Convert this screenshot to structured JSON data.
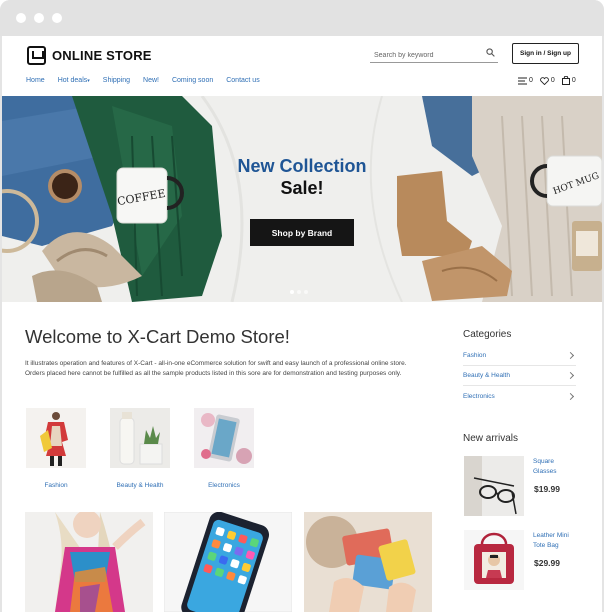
{
  "header": {
    "logo_text": "ONLINE STORE",
    "search_placeholder": "Search by keyword",
    "signin_label": "Sign in / Sign up",
    "nav": [
      "Home",
      "Hot deals",
      "Shipping",
      "New!",
      "Coming soon",
      "Contact us"
    ],
    "icons": [
      {
        "name": "compare-icon",
        "count": "0"
      },
      {
        "name": "wishlist-icon",
        "count": "0"
      },
      {
        "name": "cart-icon",
        "count": "0"
      }
    ]
  },
  "hero": {
    "title": "New Collection",
    "subtitle": "Sale!",
    "button_label": "Shop by Brand",
    "mug_text_left": "COFFEE",
    "mug_text_right": "HOT MUG"
  },
  "main": {
    "heading": "Welcome to X-Cart Demo Store!",
    "intro": "It illustrates operation and features of X-Cart - all-in-one eCommerce solution for swift and easy launch of a professional online store. Orders placed here cannot be fulfilled as all the sample products listed in this sore are for demonstration and testing purposes only.",
    "categories": [
      "Fashion",
      "Beauty & Health",
      "Electronics"
    ]
  },
  "sidebar": {
    "categories_title": "Categories",
    "categories": [
      "Fashion",
      "Beauty & Health",
      "Electronics"
    ],
    "arrivals_title": "New arrivals",
    "arrivals": [
      {
        "name": "Square Glasses",
        "price": "$19.99"
      },
      {
        "name": "Leather Mini Tote Bag",
        "price": "$29.99"
      }
    ]
  },
  "colors": {
    "accent_blue": "#1f5595",
    "link_blue": "#2f6fb5",
    "button_dark": "#151515"
  }
}
